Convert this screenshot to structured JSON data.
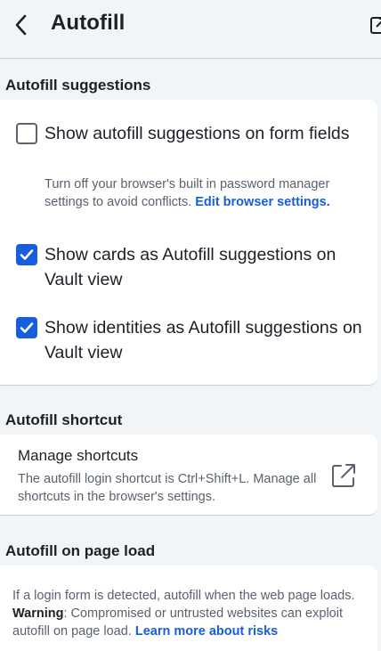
{
  "header": {
    "title": "Autofill",
    "back_icon": "chevron-left-icon",
    "popout_icon": "popout-icon"
  },
  "suggestions": {
    "heading": "Autofill suggestions",
    "items": [
      {
        "label": "Show autofill suggestions on form fields",
        "checked": false,
        "hint": "Turn off your browser's built in password manager settings to avoid conflicts.",
        "hint_link": "Edit browser settings."
      },
      {
        "label": "Show cards as Autofill suggestions on Vault view",
        "checked": true
      },
      {
        "label": "Show identities as Autofill suggestions on Vault view",
        "checked": true
      }
    ]
  },
  "shortcut": {
    "heading": "Autofill shortcut",
    "title": "Manage shortcuts",
    "description": "The autofill login shortcut is Ctrl+Shift+L. Manage all shortcuts in the browser's settings.",
    "link_icon": "external-link-icon"
  },
  "page_load": {
    "heading": "Autofill on page load",
    "text_before": "If a login form is detected, autofill when the web page loads.",
    "warning_label": "Warning",
    "text_after": ": Compromised or untrusted websites can exploit autofill on page load.",
    "link": "Learn more about risks"
  },
  "colors": {
    "background": "#f2f5f8",
    "card": "#ffffff",
    "accent": "#175ddc",
    "muted_text": "#5a6270"
  }
}
